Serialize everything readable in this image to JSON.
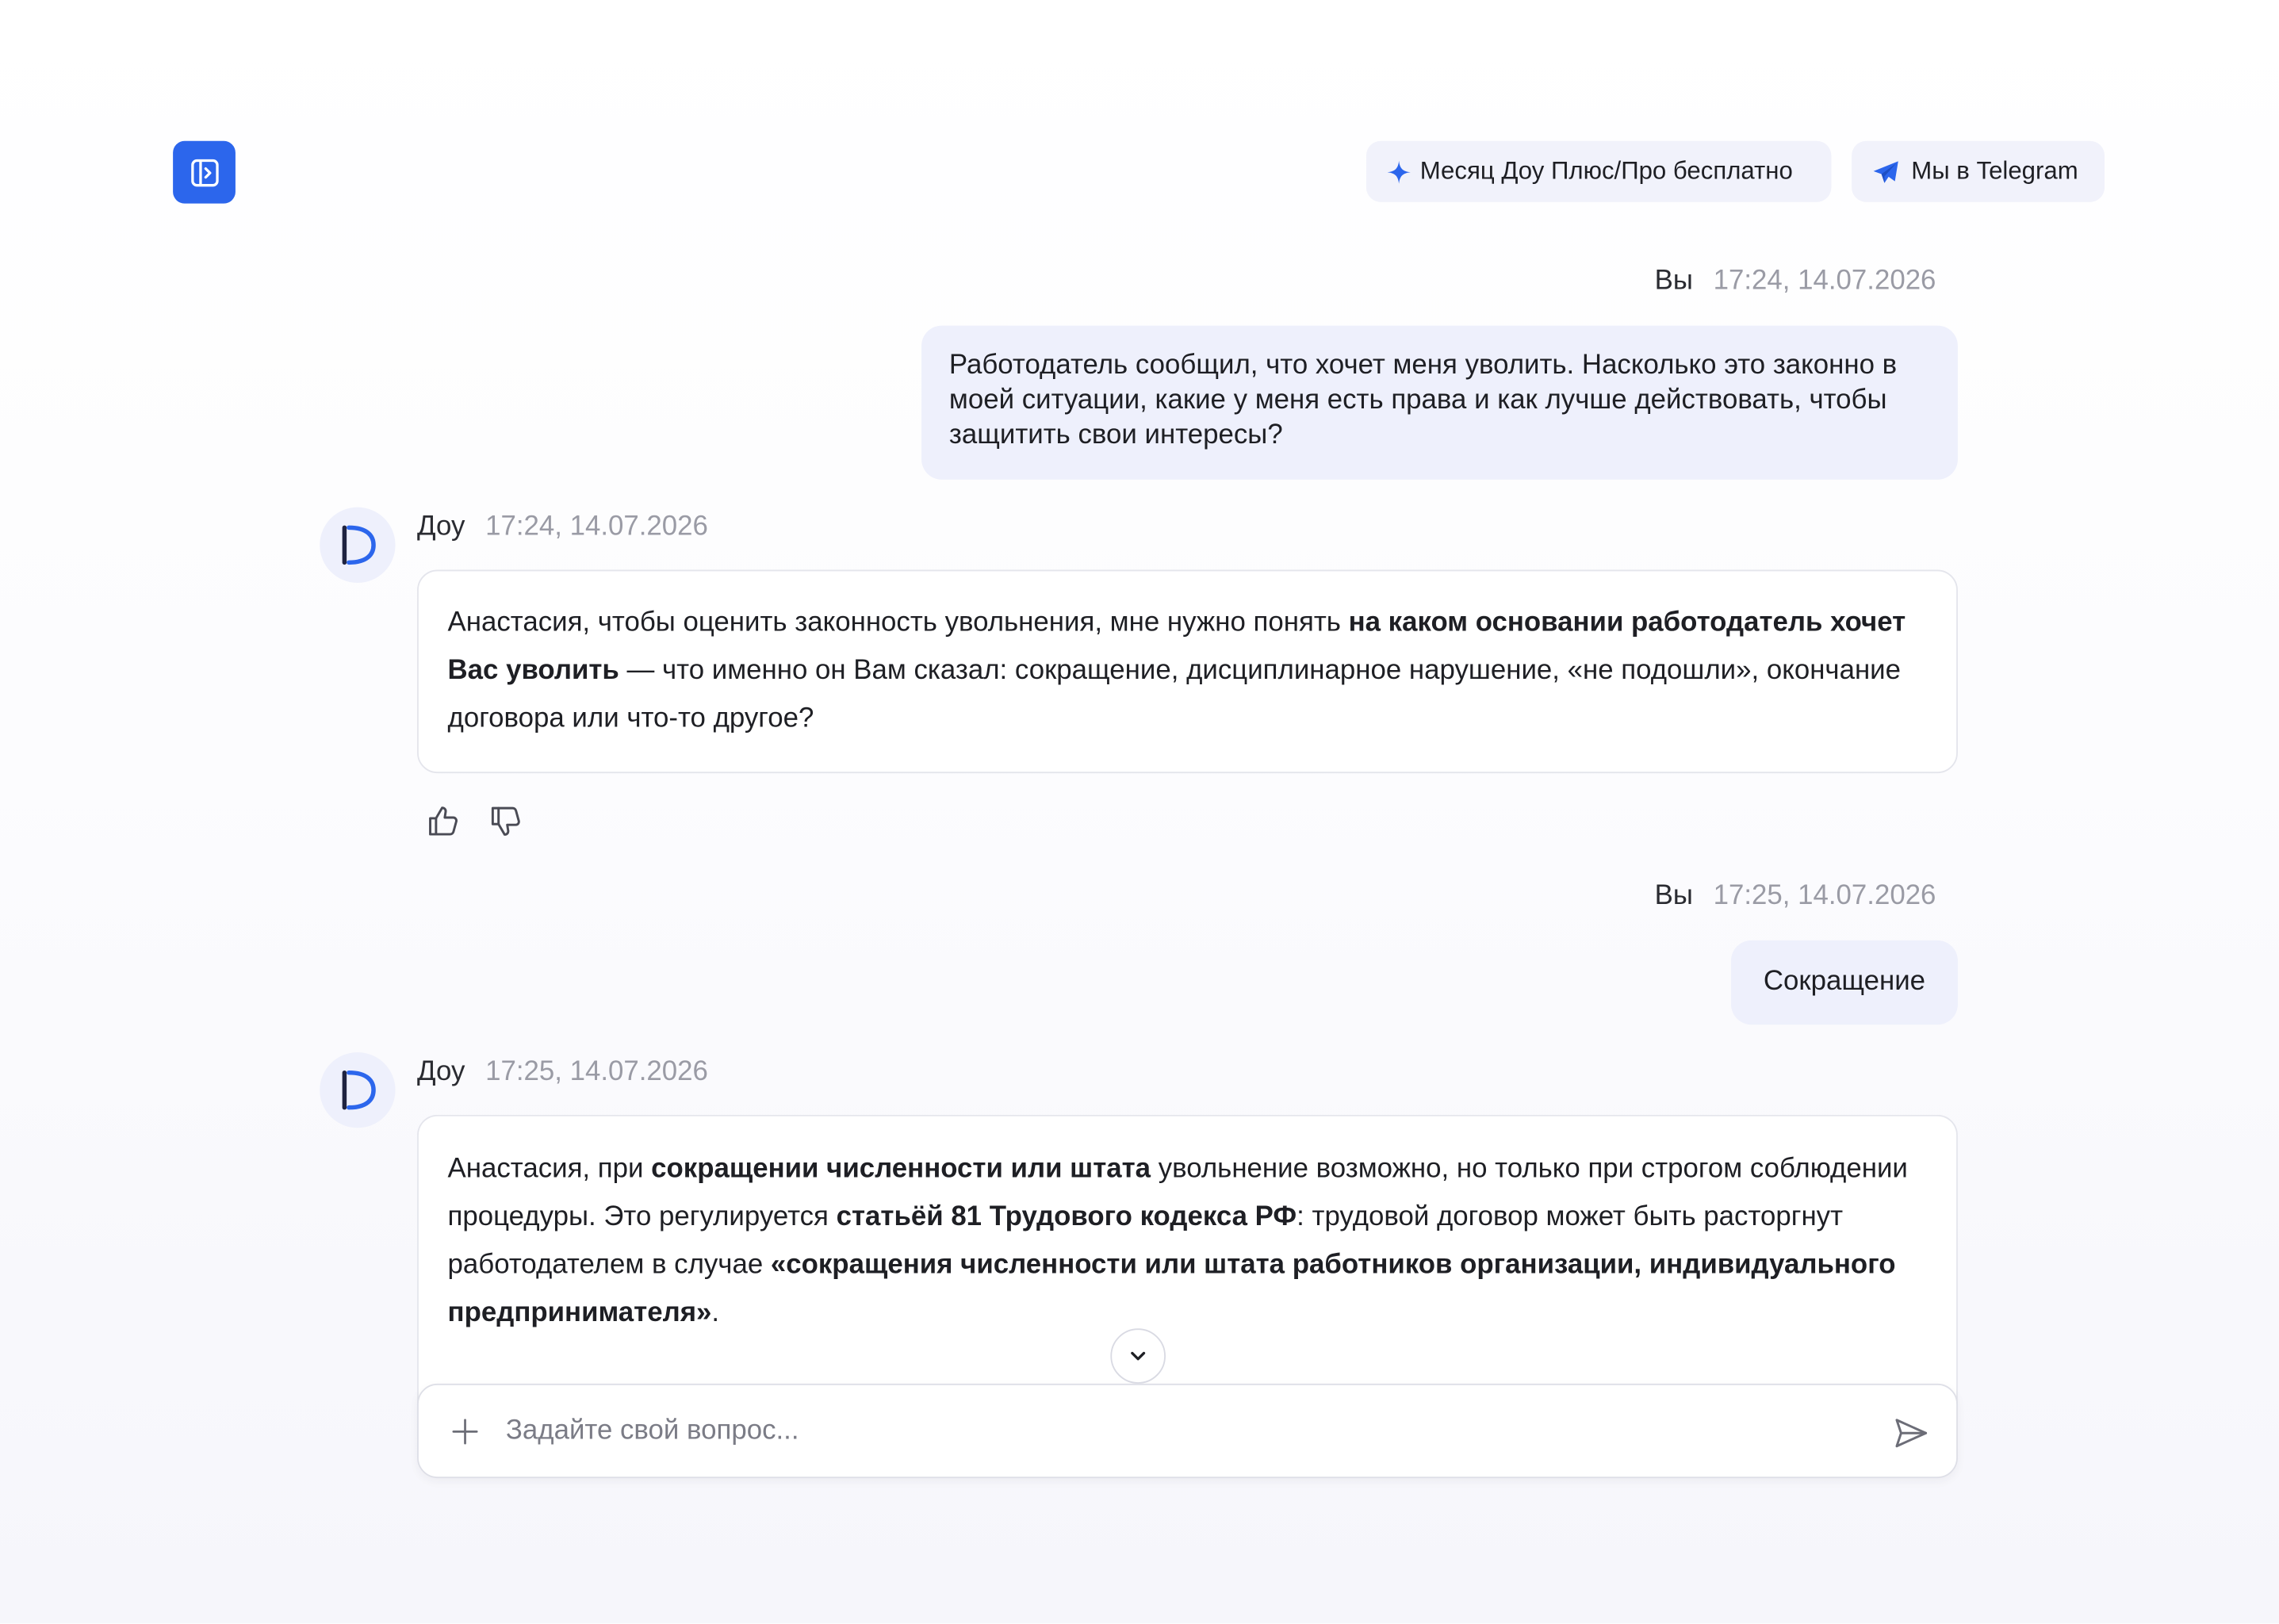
{
  "header": {
    "sidebar_toggle_icon": "sidebar-toggle-icon",
    "promo_label": "Месяц Доу Плюс/Про бесплатно",
    "promo_icon": "sparkle-icon",
    "telegram_label": "Мы в Telegram",
    "telegram_icon": "telegram-icon"
  },
  "colors": {
    "accent": "#2c66ec",
    "user_bubble": "#eef0fc",
    "pill_bg": "#f1f2fb",
    "timestamp": "#9a9ba5"
  },
  "messages": [
    {
      "role": "user",
      "author": "Вы",
      "time": "17:24, 14.07.2026",
      "text": "Работодатель сообщил, что хочет меня уволить. Насколько это законно в моей ситуации, какие у меня есть права и как лучше действовать, чтобы защитить свои интересы?"
    },
    {
      "role": "assistant",
      "author": "Доу",
      "time": "17:24, 14.07.2026",
      "segments": [
        {
          "text": "Анастасия, чтобы оценить законность увольнения, мне нужно понять ",
          "bold": false
        },
        {
          "text": "на каком основании работодатель хочет Вас уволить",
          "bold": true
        },
        {
          "text": " — что именно он Вам сказал: сокращение, дисциплинарное нарушение, «не подошли», окончание договора или что-то другое?",
          "bold": false
        }
      ]
    },
    {
      "role": "user",
      "author": "Вы",
      "time": "17:25, 14.07.2026",
      "text": "Сокращение"
    },
    {
      "role": "assistant",
      "author": "Доу",
      "time": "17:25, 14.07.2026",
      "segments": [
        {
          "text": "Анастасия, при ",
          "bold": false
        },
        {
          "text": "сокращении численности или штата",
          "bold": true
        },
        {
          "text": " увольнение возможно, но только при строгом соблюдении процедуры. Это регулируется ",
          "bold": false
        },
        {
          "text": "статьёй 81 Трудового кодекса РФ",
          "bold": true
        },
        {
          "text": ": трудовой договор может быть расторгнут работодателем в случае ",
          "bold": false
        },
        {
          "text": "«сокращения численности или штата работников организации, индивидуального предпринимателя»",
          "bold": true
        },
        {
          "text": ".",
          "bold": false
        }
      ]
    }
  ],
  "feedback": {
    "like_icon": "thumbs-up-icon",
    "dislike_icon": "thumbs-down-icon"
  },
  "composer": {
    "placeholder": "Задайте свой вопрос...",
    "value": "",
    "attach_icon": "plus-icon",
    "send_icon": "send-icon",
    "scroll_icon": "chevron-down-icon"
  }
}
